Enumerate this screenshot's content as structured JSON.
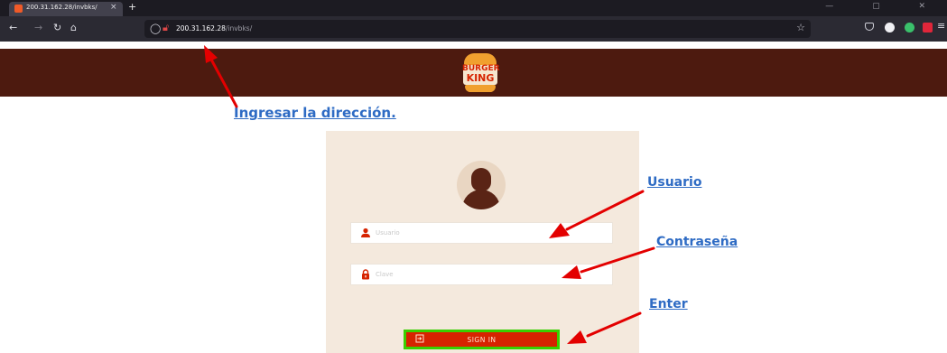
{
  "browser": {
    "tab_title": "200.31.162.28/invbks/",
    "tab_close": "×",
    "new_tab": "+",
    "window_controls": "—  ▢  ✕",
    "nav": {
      "back": "←",
      "forward": "→",
      "reload": "↻",
      "home": "⌂"
    },
    "url_host": "200.31.162.28",
    "url_path": "/invbks/",
    "bookmark": "☆",
    "menu": "≡"
  },
  "header": {
    "logo_line1": "BURGER",
    "logo_line2": "KING",
    "background": "#4d1a0f",
    "brand_red": "#d62300",
    "brand_orange": "#f0a02f"
  },
  "login": {
    "username_placeholder": "Usuario",
    "password_placeholder": "Clave",
    "submit_label": "SIGN IN",
    "card_color": "#f4e9dd"
  },
  "annotations": {
    "address": "Ingresar la dirección.",
    "user": "Usuario",
    "password": "Contraseña",
    "enter": "Enter",
    "arrow_color": "#e30000",
    "text_color": "#2e6bc4",
    "highlight_color": "#39d000"
  }
}
